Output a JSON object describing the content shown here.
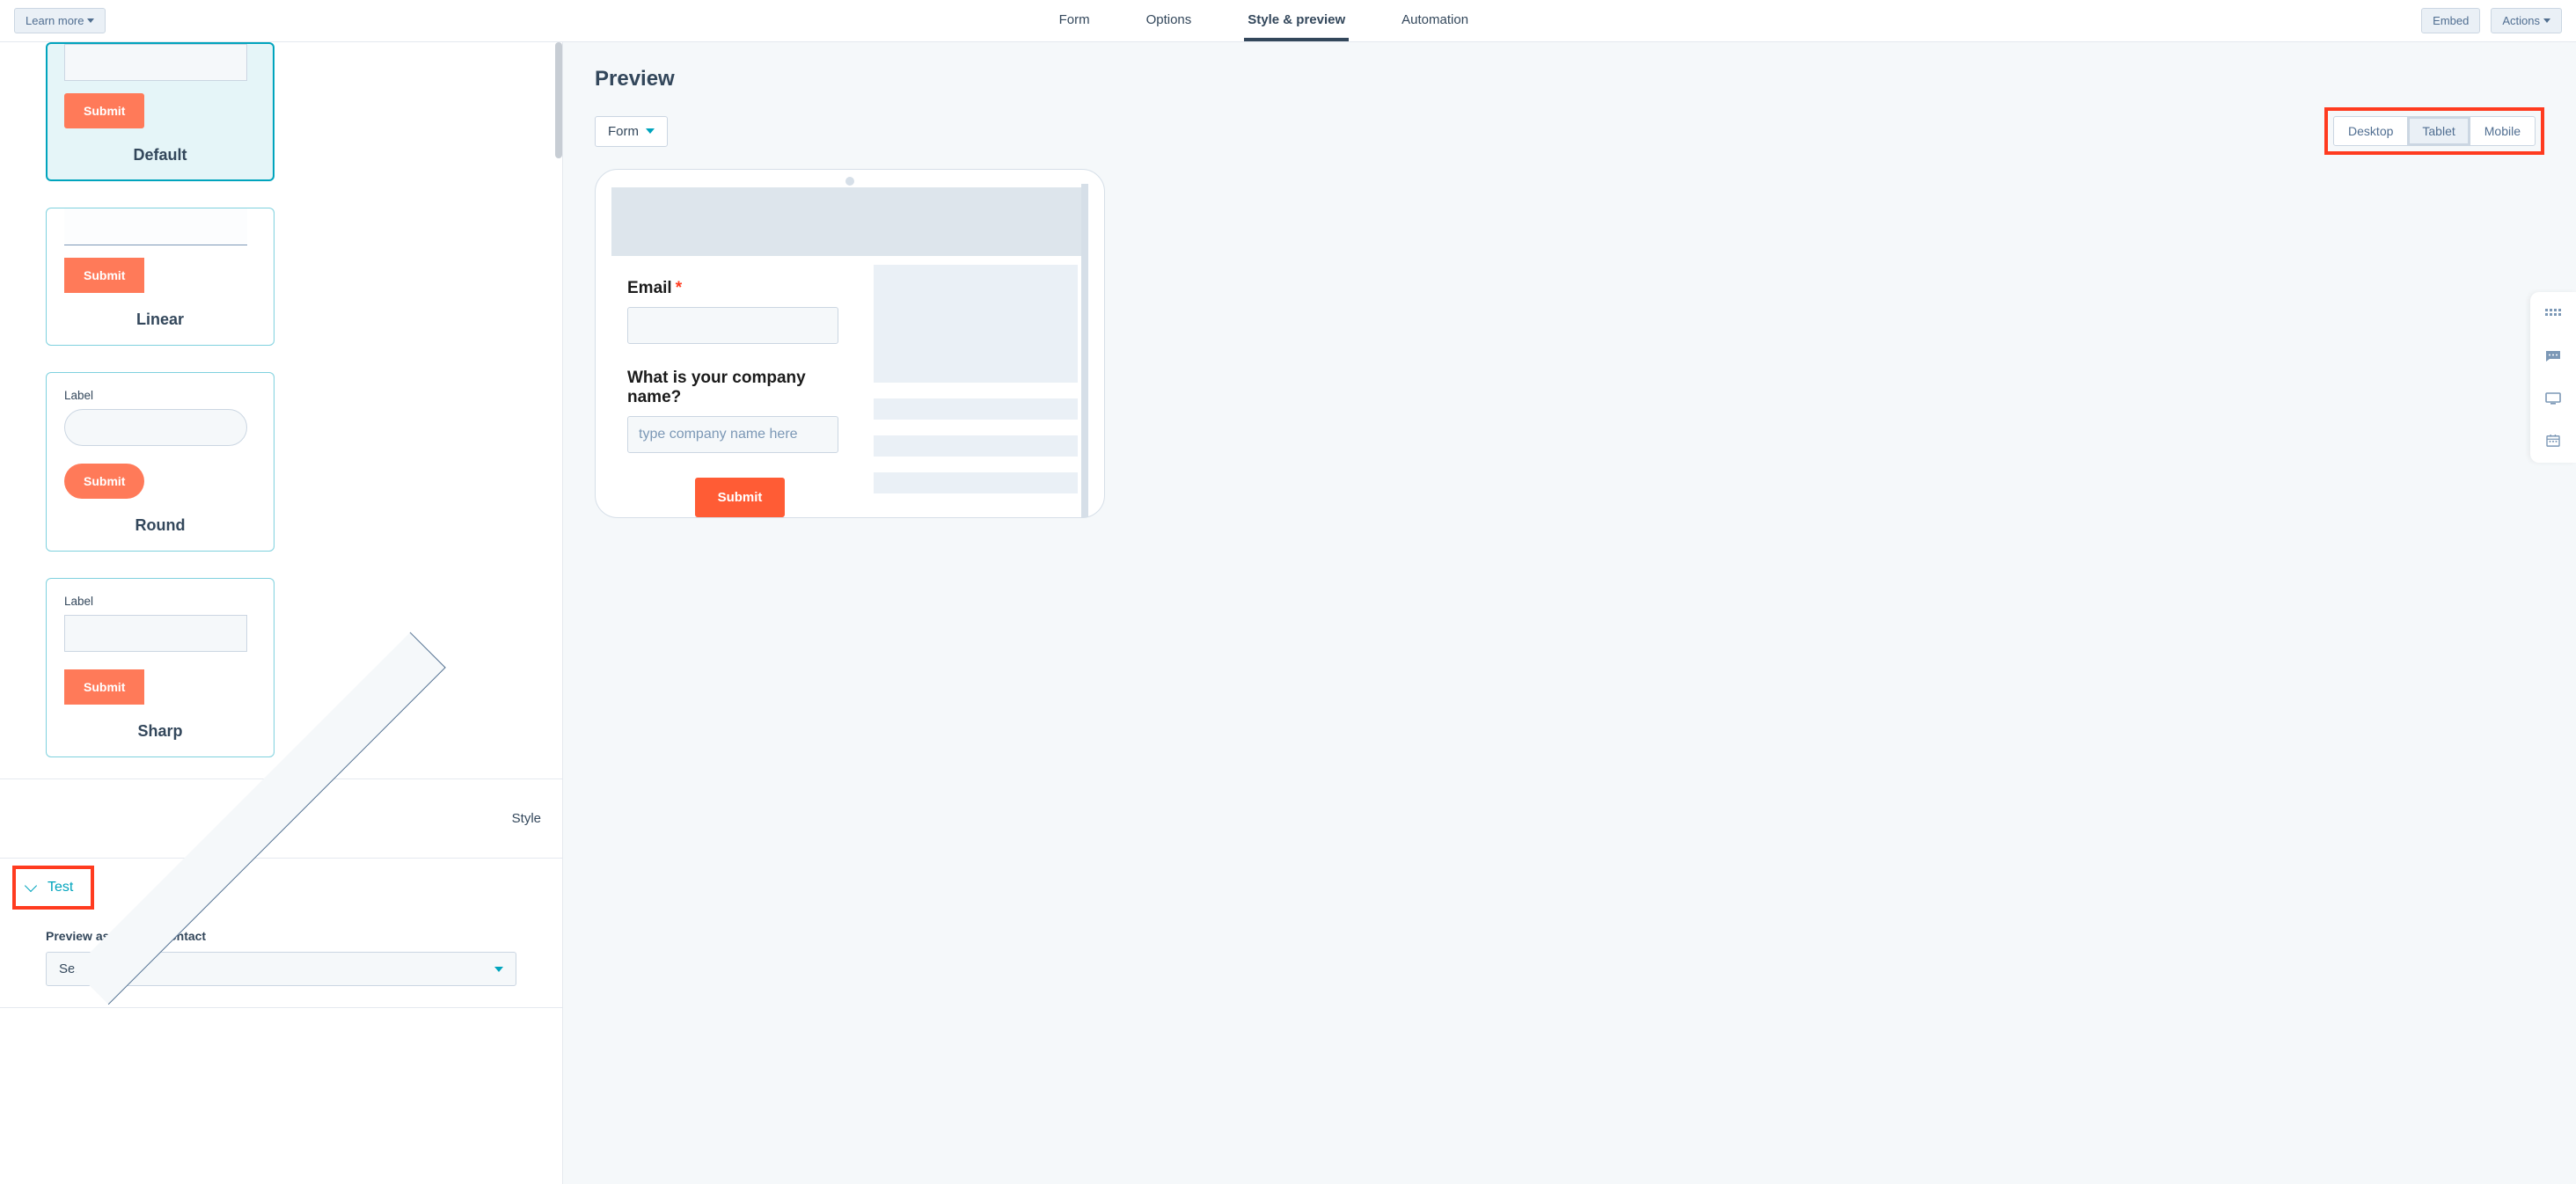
{
  "topnav": {
    "learn_more": "Learn more",
    "tabs": [
      "Form",
      "Options",
      "Style & preview",
      "Automation"
    ],
    "active_tab": 2,
    "embed": "Embed",
    "actions": "Actions"
  },
  "style_cards": [
    {
      "label": "",
      "title": "Default",
      "submit": "Submit",
      "kind": "default",
      "selected": true
    },
    {
      "label": "",
      "title": "Linear",
      "submit": "Submit",
      "kind": "linear",
      "selected": false
    },
    {
      "label": "Label",
      "title": "Round",
      "submit": "Submit",
      "kind": "round",
      "selected": false
    },
    {
      "label": "Label",
      "title": "Sharp",
      "submit": "Submit",
      "kind": "sharp",
      "selected": false
    }
  ],
  "accordion": {
    "style": "Style",
    "test": "Test",
    "preview_as": "Preview as specific contact",
    "search_placeholder": "Search"
  },
  "preview": {
    "heading": "Preview",
    "form_dd": "Form",
    "devices": [
      "Desktop",
      "Tablet",
      "Mobile"
    ],
    "active_device": 1,
    "fields": [
      {
        "label": "Email",
        "required": true,
        "placeholder": ""
      },
      {
        "label": "What is your company name?",
        "required": false,
        "placeholder": "type company name here"
      }
    ],
    "submit": "Submit"
  }
}
